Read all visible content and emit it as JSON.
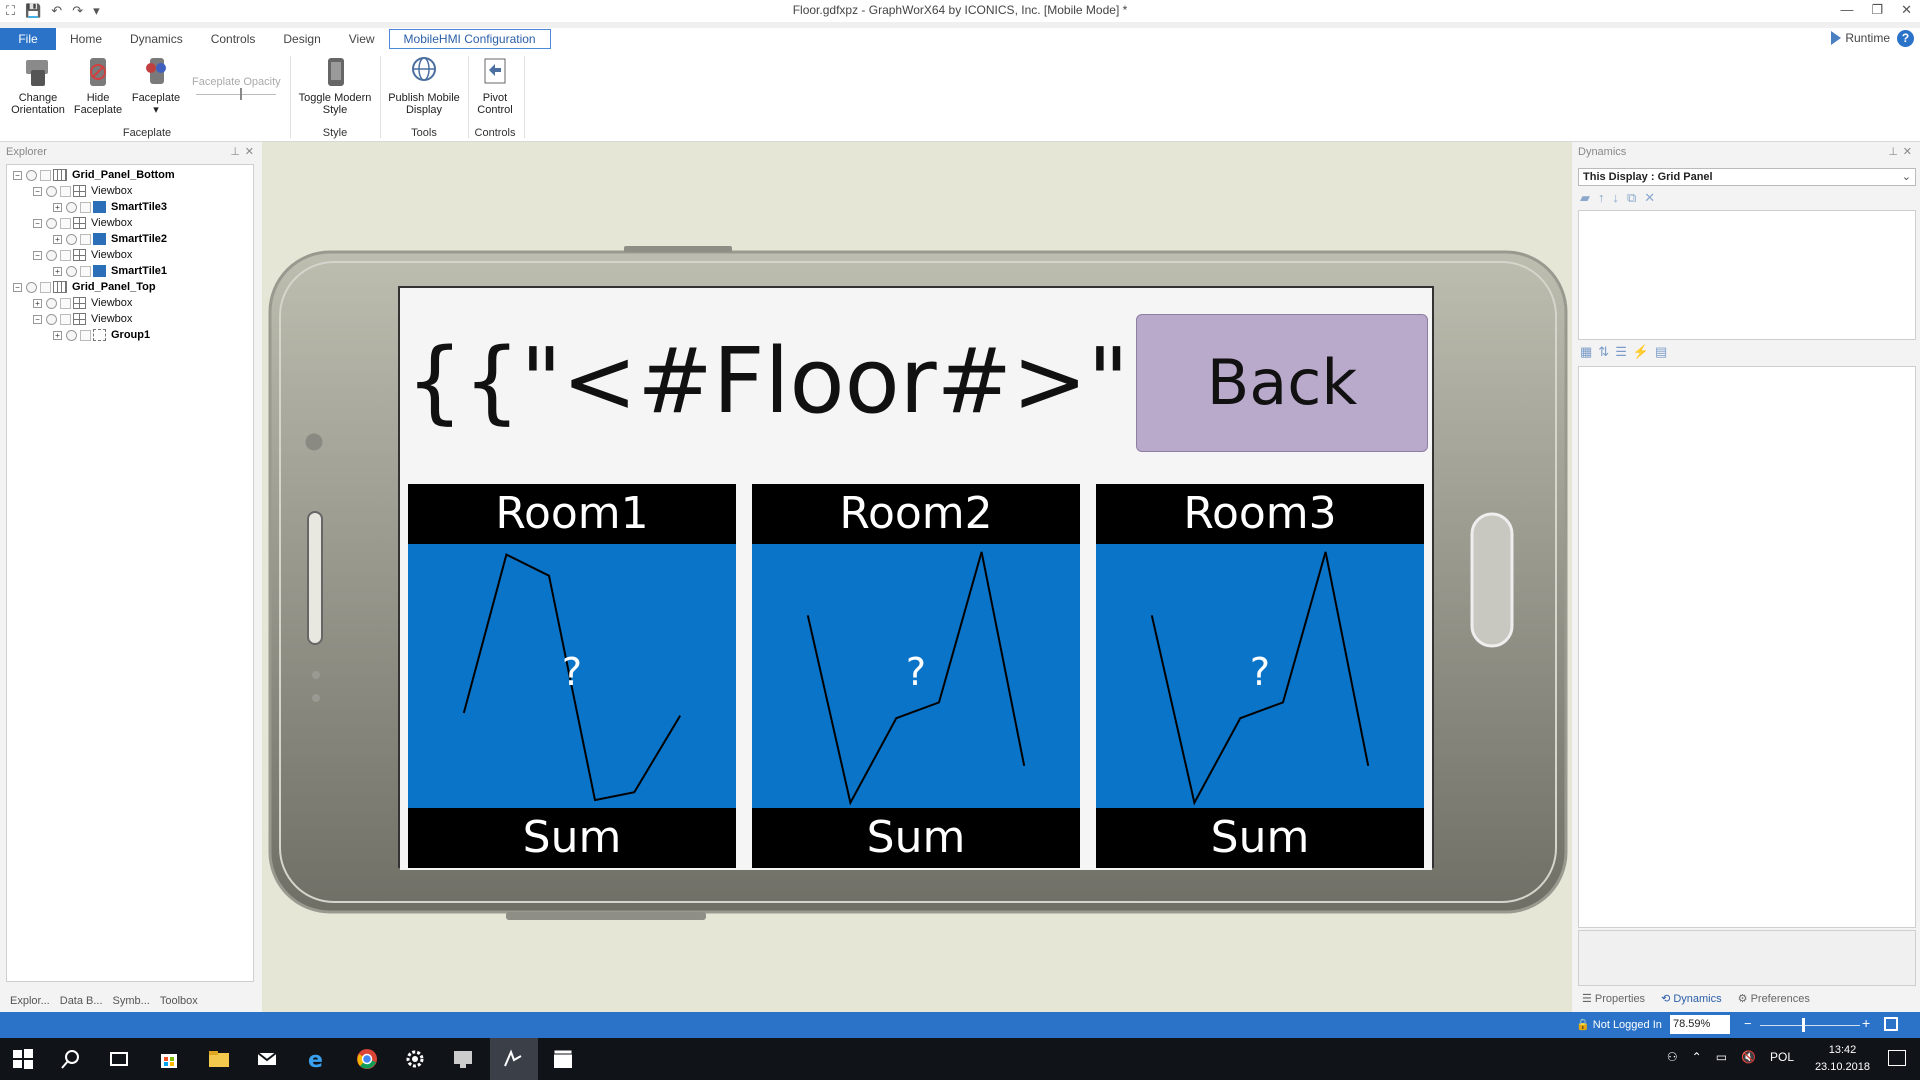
{
  "window": {
    "title": "Floor.gdfxpz - GraphWorX64 by ICONICS, Inc. [Mobile Mode] *"
  },
  "menu": {
    "tabs": [
      "File",
      "Home",
      "Dynamics",
      "Controls",
      "Design",
      "View",
      "MobileHMI Configuration"
    ],
    "runtime_label": "Runtime",
    "help_label": "?"
  },
  "ribbon": {
    "change_orientation": "Change Orientation",
    "hide_faceplate": "Hide Faceplate",
    "faceplate": "Faceplate",
    "faceplate_opacity": "Faceplate Opacity",
    "toggle_modern_style": "Toggle Modern Style",
    "publish_mobile_display": "Publish Mobile Display",
    "pivot_control": "Pivot Control",
    "group_faceplate": "Faceplate",
    "group_style": "Style",
    "group_tools": "Tools",
    "group_controls": "Controls"
  },
  "explorer": {
    "title": "Explorer",
    "nodes": [
      {
        "label": "Grid_Panel_Bottom",
        "bold": true
      },
      {
        "label": "Viewbox",
        "bold": false
      },
      {
        "label": "SmartTile3",
        "bold": true
      },
      {
        "label": "Viewbox",
        "bold": false
      },
      {
        "label": "SmartTile2",
        "bold": true
      },
      {
        "label": "Viewbox",
        "bold": false
      },
      {
        "label": "SmartTile1",
        "bold": true
      },
      {
        "label": "Grid_Panel_Top",
        "bold": true
      },
      {
        "label": "Viewbox",
        "bold": false
      },
      {
        "label": "Viewbox",
        "bold": false
      },
      {
        "label": "Group1",
        "bold": true
      }
    ],
    "bottom_tabs": [
      "Explor...",
      "Data B...",
      "Symb...",
      "Toolbox"
    ]
  },
  "display": {
    "header_text": "{{\"<#Floor#>\"}}",
    "back_label": "Back",
    "tiles": [
      {
        "title": "Room1",
        "value": "?",
        "footer": "Sum",
        "trend": [
          [
            0.17,
            0.36
          ],
          [
            0.3,
            0.96
          ],
          [
            0.43,
            0.88
          ],
          [
            0.57,
            0.03
          ],
          [
            0.69,
            0.06
          ],
          [
            0.83,
            0.35
          ]
        ]
      },
      {
        "title": "Room2",
        "value": "?",
        "footer": "Sum",
        "trend": [
          [
            0.17,
            0.73
          ],
          [
            0.3,
            0.02
          ],
          [
            0.44,
            0.34
          ],
          [
            0.57,
            0.4
          ],
          [
            0.7,
            0.97
          ],
          [
            0.83,
            0.16
          ]
        ]
      },
      {
        "title": "Room3",
        "value": "?",
        "footer": "Sum",
        "trend": [
          [
            0.17,
            0.73
          ],
          [
            0.3,
            0.02
          ],
          [
            0.44,
            0.34
          ],
          [
            0.57,
            0.4
          ],
          [
            0.7,
            0.97
          ],
          [
            0.83,
            0.16
          ]
        ]
      }
    ],
    "colors": {
      "tile_blue": "#0a74c8",
      "back_button": "#b9a9cb"
    }
  },
  "dynamics": {
    "title": "Dynamics",
    "selector": "This Display : Grid Panel",
    "tabs": [
      "Properties",
      "Dynamics",
      "Preferences"
    ]
  },
  "status": {
    "login": "Not Logged In",
    "zoom": "78.59%"
  },
  "taskbar": {
    "lang": "POL",
    "time": "13:42",
    "date": "23.10.2018"
  }
}
